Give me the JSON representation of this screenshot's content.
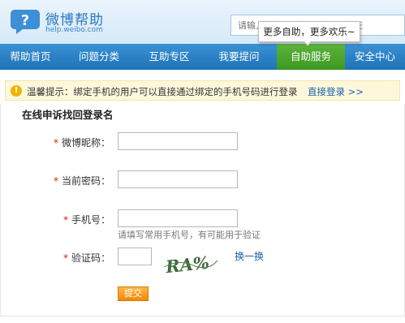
{
  "header": {
    "site_title": "微博帮助",
    "site_url": "help.weibo.com",
    "search_placeholder": "请输入搜索词，如：密码，认证",
    "tooltip_text": "更多自助，更多欢乐~"
  },
  "nav": {
    "items": [
      {
        "label": "帮助首页",
        "icon": null
      },
      {
        "label": "问题分类",
        "icon": null
      },
      {
        "label": "互助专区",
        "icon": null
      },
      {
        "label": "我要提问",
        "icon": null
      },
      {
        "label": "自助服务",
        "icon": null,
        "active": true
      },
      {
        "label": "安全中心",
        "icon": null
      }
    ],
    "active_color": "#4aa62c",
    "bar_color": "#2b82c6"
  },
  "notice": {
    "text": "温馨提示：绑定手机的用户可以直接通过绑定的手机号码进行登录",
    "link_text": "直接登录 >>",
    "icon": "warning-icon"
  },
  "form": {
    "title": "在线申诉找回登录名",
    "required_mark": "*",
    "fields": {
      "nickname_label": "微博昵称：",
      "password_label": "当前密码：",
      "phone_label": "手机号：",
      "phone_hint": "请填写常用手机号，有可能用于验证",
      "captcha_label": "验证码："
    },
    "captcha_text": "RA%",
    "refresh_label": "换一换",
    "submit_label": "提交"
  },
  "colors": {
    "accent": "#2a78c2",
    "required": "#d81e06",
    "submit": "#f39a1a",
    "link": "#1a5fa8"
  }
}
